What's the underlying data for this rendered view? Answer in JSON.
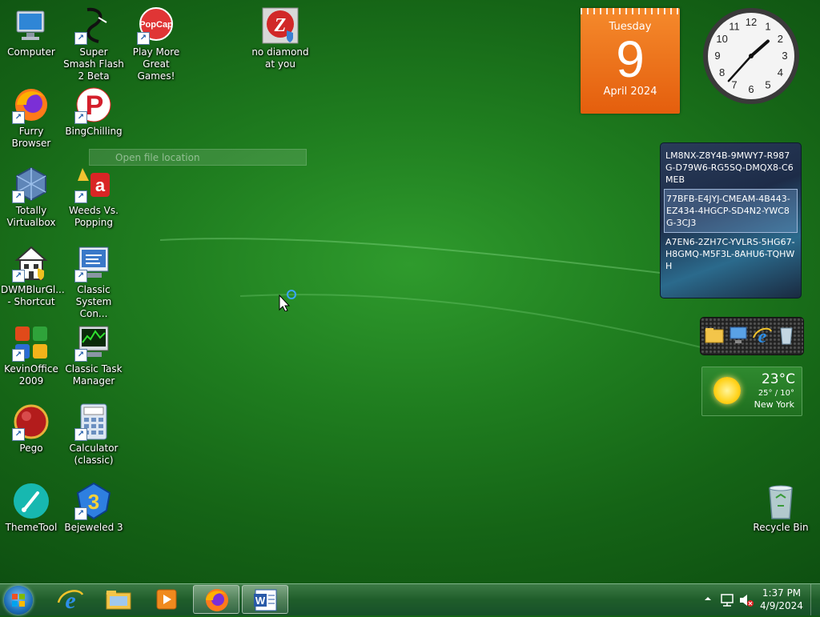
{
  "desktop": {
    "icons": [
      {
        "label": "Computer"
      },
      {
        "label": "Super Smash Flash 2 Beta"
      },
      {
        "label": "Play More Great Games!"
      },
      {
        "label": "no diamond at you"
      },
      {
        "label": "Furry Browser"
      },
      {
        "label": "BingChilling"
      },
      {
        "label": "Totally Virtualbox"
      },
      {
        "label": "Weeds Vs. Popping"
      },
      {
        "label": "DWMBlurGl... - Shortcut"
      },
      {
        "label": "Classic System Con..."
      },
      {
        "label": "KevinOffice 2009"
      },
      {
        "label": "Classic Task Manager"
      },
      {
        "label": "Pego"
      },
      {
        "label": "Calculator (classic)"
      },
      {
        "label": "ThemeTool"
      },
      {
        "label": "Bejeweled 3"
      },
      {
        "label": "Recycle Bin"
      }
    ],
    "context_menu_item": "Open file location"
  },
  "gadgets": {
    "calendar": {
      "weekday": "Tuesday",
      "day": "9",
      "month_year": "April 2024"
    },
    "clock": {
      "hour": 1,
      "minute": 37
    },
    "notes": [
      "LM8NX-Z8Y4B-9MWY7-R987G-D79W6-RG5SQ-DMQX8-C6MEB",
      "77BFB-E4JYJ-CMEAM-4B443-EZ434-4HGCP-SD4N2-YWC8G-3CJ3",
      "A7EN6-2ZH7C-YVLRS-5HG67-H8GMQ-M5F3L-8AHU6-TQHWH"
    ],
    "weather": {
      "temp": "23°C",
      "high_low": "25° / 10°",
      "city": "New York"
    }
  },
  "taskbar": {
    "items": [
      "start-orb",
      "internet-explorer",
      "file-explorer",
      "media-player",
      "firefox",
      "word"
    ],
    "time": "1:37 PM",
    "date": "4/9/2024"
  },
  "colors": {
    "accent": "#1f7d1f",
    "calendar": "#e8671a"
  }
}
